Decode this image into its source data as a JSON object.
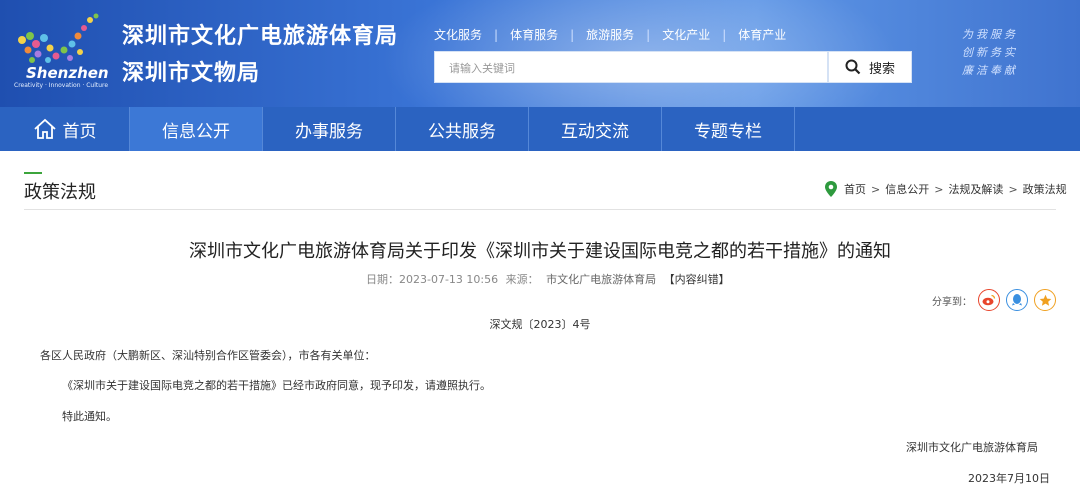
{
  "header": {
    "logo_city": "Shenzhen",
    "logo_small": "Creativity · Innovation · Culture",
    "org_name_1": "深圳市文化广电旅游体育局",
    "org_name_2": "深圳市文物局",
    "top_nav": [
      "文化服务",
      "体育服务",
      "旅游服务",
      "文化产业",
      "体育产业"
    ],
    "search_placeholder": "请输入关键词",
    "search_button": "搜索",
    "slogan": [
      "为我服务",
      "创新务实",
      "廉洁奉献"
    ]
  },
  "main_nav": {
    "items": [
      "首页",
      "信息公开",
      "办事服务",
      "公共服务",
      "互动交流",
      "专题专栏"
    ],
    "active": "信息公开"
  },
  "section": {
    "title": "政策法规",
    "breadcrumb": [
      "首页",
      "信息公开",
      "法规及解读",
      "政策法规"
    ]
  },
  "article": {
    "title": "深圳市文化广电旅游体育局关于印发《深圳市关于建设国际电竞之都的若干措施》的通知",
    "date_label": "日期：",
    "date": "2023-07-13 10:56",
    "source_label": "来源：",
    "source": "市文化广电旅游体育局",
    "correction": "【内容纠错】",
    "share_label": "分享到：",
    "doc_number": "深文规〔2023〕4号",
    "salutation": "各区人民政府（大鹏新区、深汕特别合作区管委会），市各有关单位：",
    "body": "《深圳市关于建设国际电竞之都的若干措施》已经市政府同意，现予印发，请遵照执行。",
    "closing": "特此通知。",
    "signature": "深圳市文化广电旅游体育局",
    "sign_date": "2023年7月10日"
  },
  "colors": {
    "header_blue": "#2b63c1",
    "nav_active": "#3c78d6",
    "accent_green": "#3ca53c",
    "weibo_red": "#e8452c",
    "qq_blue": "#3a8fe0",
    "star_orange": "#f0a020"
  }
}
